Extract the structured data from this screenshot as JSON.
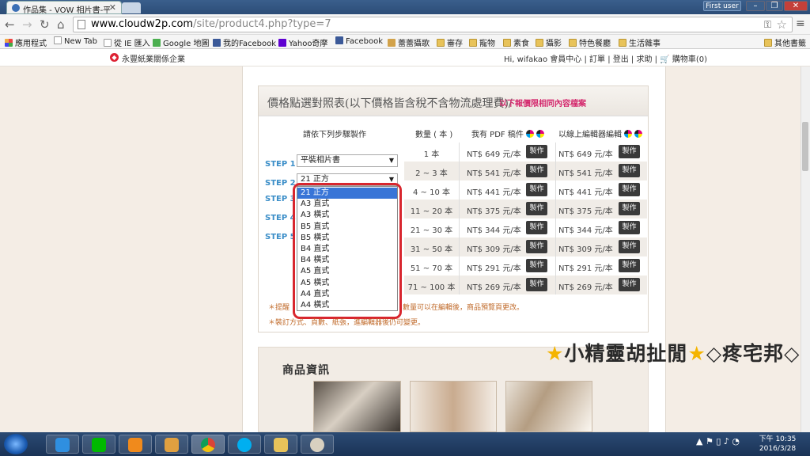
{
  "browser": {
    "tab_title": "作品集 - VOW 相片書-平",
    "user_button": "First user",
    "url_host": "www.cloudw2p.com",
    "url_path": "/site/product4.php?type=7",
    "bookmarks": [
      "應用程式",
      "New Tab",
      "從 IE 匯入",
      "Google 地圖",
      "我的Facebook",
      "Yahoo奇摩",
      "Facebook",
      "蕾蕾攝歌",
      "審存",
      "寵物",
      "素食",
      "攝影",
      "特色餐廳",
      "生活雜事",
      "其他書籤"
    ]
  },
  "site": {
    "logo_text": "永豐紙業關係企業",
    "user_nav": "Hi, wifakao 會員中心 | 訂單 | 登出 | 求助 | 🛒 購物車(0)"
  },
  "price": {
    "title": "價格點選對照表(以下價格皆含稅不含物流處理費)/",
    "note": "以下報價限相同內容檔案",
    "col_steps": "請依下列步驟製作",
    "col_qty": "數量 ( 本 )",
    "col_pdf": "我有 PDF 稿件",
    "col_online": "以線上編輯器編輯",
    "make_label": "製作",
    "rows": [
      {
        "qty": "1 本",
        "pdf": "NT$ 649 元/本",
        "online": "NT$ 649 元/本"
      },
      {
        "qty": "2 ~ 3 本",
        "pdf": "NT$ 541 元/本",
        "online": "NT$ 541 元/本"
      },
      {
        "qty": "4 ~ 10 本",
        "pdf": "NT$ 441 元/本",
        "online": "NT$ 441 元/本"
      },
      {
        "qty": "11 ~ 20 本",
        "pdf": "NT$ 375 元/本",
        "online": "NT$ 375 元/本"
      },
      {
        "qty": "21 ~ 30 本",
        "pdf": "NT$ 344 元/本",
        "online": "NT$ 344 元/本"
      },
      {
        "qty": "31 ~ 50 本",
        "pdf": "NT$ 309 元/本",
        "online": "NT$ 309 元/本"
      },
      {
        "qty": "51 ~ 70 本",
        "pdf": "NT$ 291 元/本",
        "online": "NT$ 291 元/本"
      },
      {
        "qty": "71 ~ 100 本",
        "pdf": "NT$ 269 元/本",
        "online": "NT$ 269 元/本"
      }
    ],
    "steps": [
      "STEP 1：",
      "STEP 2：",
      "STEP 3",
      "STEP 4",
      "STEP 5"
    ],
    "step1_value": "平裝相片書",
    "step2_value": "21 正方",
    "dropdown_options": [
      "21 正方",
      "A3 直式",
      "A3 橫式",
      "B5 直式",
      "B5 橫式",
      "B4 直式",
      "B4 橫式",
      "A5 直式",
      "A5 橫式",
      "A4 直式",
      "A4 橫式"
    ],
    "note1_left": "＊提醒",
    "note1_right": "數量可以在編輯後，商品預覽頁更改。",
    "note2": "＊裝訂方式、頁數、紙張，進編輯器後仍可變更。"
  },
  "info": {
    "title": "商品資訊"
  },
  "watermark": "★小精靈胡扯閒★◇疼宅邦◇",
  "taskbar": {
    "time": "下午 10:35",
    "date": "2016/3/28"
  }
}
